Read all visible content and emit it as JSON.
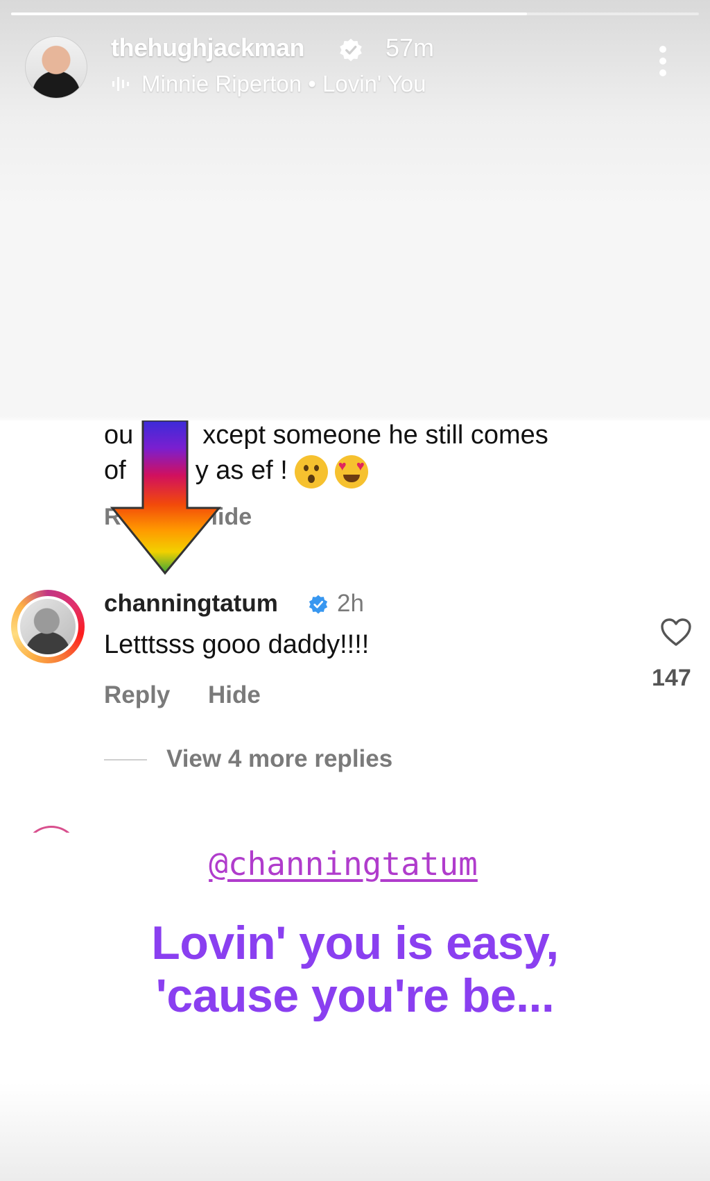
{
  "story": {
    "username": "thehughjackman",
    "time_ago": "57m",
    "music": "Minnie Riperton • Lovin' You",
    "progress": 0.75
  },
  "screenshot": {
    "cut_comment": {
      "line1_left": "ou",
      "line1_right": "xcept someone he still comes",
      "line2_left": "of",
      "line2_right": "y as ef !",
      "reply_fragment": "R",
      "hide_fragment": "lide"
    },
    "comment": {
      "username": "channingtatum",
      "time_ago": "2h",
      "text": "Letttsss gooo daddy!!!!",
      "reply_label": "Reply",
      "hide_label": "Hide",
      "likes": "147",
      "view_more": "View 4 more replies"
    }
  },
  "stickers": {
    "mention": "@channingtatum",
    "lyric_line1": "Lovin' you is easy,",
    "lyric_line2": "'cause you're be..."
  },
  "colors": {
    "lyric": "#8a3ff0",
    "mention": "#b03ccc",
    "verified_blue": "#3897f0"
  }
}
